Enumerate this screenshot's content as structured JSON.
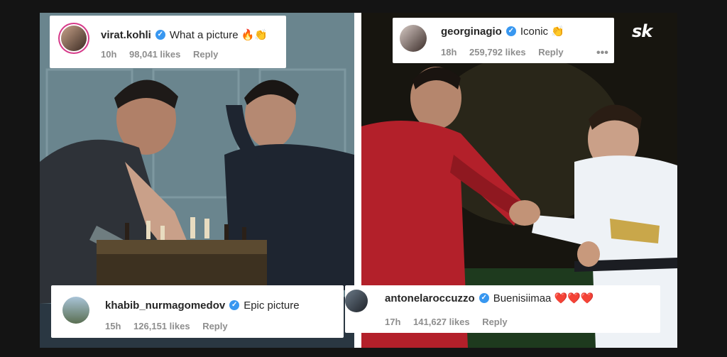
{
  "brand": {
    "logo_text": "sk"
  },
  "comments": [
    {
      "username": "virat.kohli",
      "text": "What a picture 🔥👏",
      "time": "10h",
      "likes": "98,041 likes",
      "reply": "Reply"
    },
    {
      "username": "georginagio",
      "text": "Iconic 👏",
      "time": "18h",
      "likes": "259,792 likes",
      "reply": "Reply",
      "more": "•••"
    },
    {
      "username": "khabib_nurmagomedov",
      "text": "Epic picture",
      "time": "15h",
      "likes": "126,151 likes",
      "reply": "Reply"
    },
    {
      "username": "antonelaroccuzzo",
      "text": "Buenisiimaa ❤️❤️❤️",
      "time": "17h",
      "likes": "141,627 likes",
      "reply": "Reply"
    }
  ],
  "colors": {
    "verified": "#3897f0",
    "meta": "#8e8e8e",
    "text": "#262626"
  },
  "icons": [
    "verified-badge-icon",
    "more-options-icon"
  ]
}
